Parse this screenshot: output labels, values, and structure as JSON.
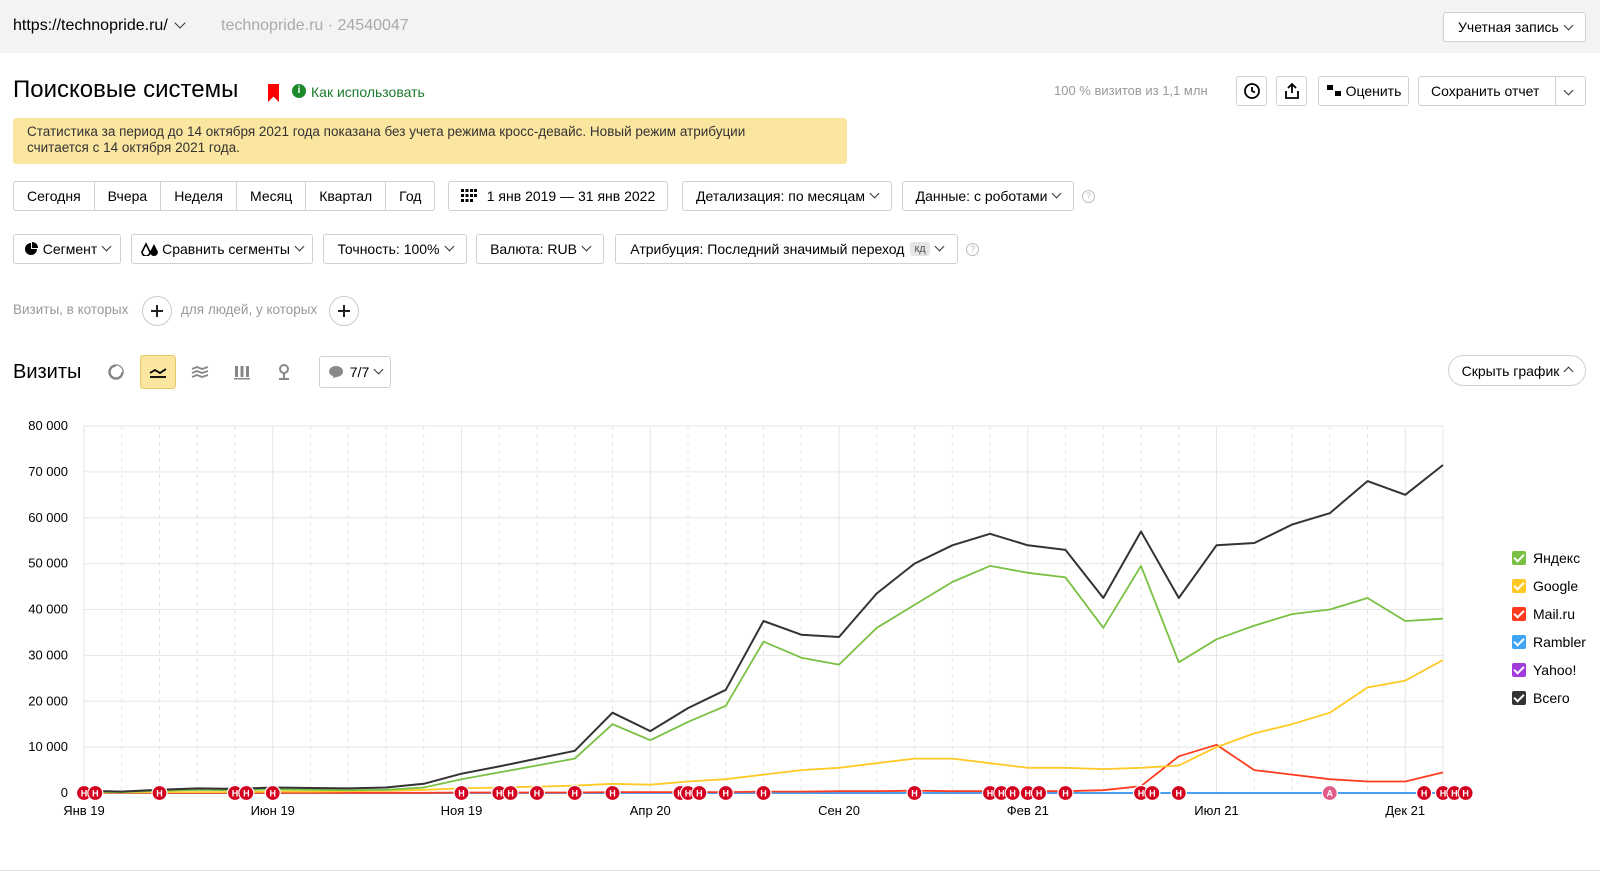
{
  "topbar": {
    "site": "https://technopride.ru/",
    "counter": "technopride.ru · 24540047",
    "account": "Учетная запись"
  },
  "header": {
    "title": "Поисковые системы",
    "howto": "Как использовать",
    "visits_share": "100 % визитов из 1,1 млн",
    "rate_label": "Оценить",
    "save_report": "Сохранить отчет"
  },
  "notice": {
    "line1": "Статистика за период до 14 октября 2021 года показана без учета режима кросс-девайс. Новый режим атрибуции",
    "line2": "считается с 14 октября 2021 года."
  },
  "period": {
    "items": [
      "Сегодня",
      "Вчера",
      "Неделя",
      "Месяц",
      "Квартал",
      "Год"
    ],
    "range": "1 янв 2019 — 31 янв 2022",
    "detail": "Детализация: по месяцам",
    "data": "Данные: с роботами"
  },
  "settings": {
    "segment": "Сегмент",
    "compare": "Сравнить сегменты",
    "accuracy": "Точность: 100%",
    "currency": "Валюта: RUB",
    "attribution": "Атрибуция: Последний значимый переход",
    "attribution_badge": "кд"
  },
  "filters": {
    "visits_label": "Визиты, в которых",
    "people_label": "для людей, у которых"
  },
  "chart_header": {
    "title": "Визиты",
    "annotations": "7/7",
    "hide": "Скрыть график"
  },
  "chart_data": {
    "type": "line",
    "ylim": [
      0,
      80000
    ],
    "yticks": [
      0,
      10000,
      20000,
      30000,
      40000,
      50000,
      60000,
      70000,
      80000
    ],
    "ytick_labels": [
      "0",
      "10 000",
      "20 000",
      "30 000",
      "40 000",
      "50 000",
      "60 000",
      "70 000",
      "80 000"
    ],
    "x_count": 37,
    "xtick_labels": [
      {
        "i": 0,
        "label": "Янв 19"
      },
      {
        "i": 5,
        "label": "Июн 19"
      },
      {
        "i": 10,
        "label": "Ноя 19"
      },
      {
        "i": 15,
        "label": "Апр 20"
      },
      {
        "i": 20,
        "label": "Сен 20"
      },
      {
        "i": 25,
        "label": "Фев 21"
      },
      {
        "i": 30,
        "label": "Июл 21"
      },
      {
        "i": 35,
        "label": "Дек 21"
      }
    ],
    "series": [
      {
        "name": "Яндекс",
        "color": "#7ac143",
        "values": [
          300,
          200,
          500,
          700,
          600,
          800,
          700,
          600,
          700,
          1200,
          3000,
          4500,
          6000,
          7500,
          15000,
          11500,
          15500,
          19000,
          33000,
          29500,
          28000,
          36000,
          41000,
          46000,
          49500,
          48000,
          47000,
          36000,
          49500,
          28500,
          33500,
          36500,
          39000,
          40000,
          42500,
          37500,
          38000
        ]
      },
      {
        "name": "Google",
        "color": "#ffc926",
        "values": [
          100,
          100,
          200,
          200,
          200,
          300,
          300,
          400,
          500,
          700,
          1000,
          1200,
          1400,
          1600,
          2000,
          1800,
          2500,
          3000,
          4000,
          5000,
          5500,
          6500,
          7500,
          7500,
          6500,
          5500,
          5500,
          5200,
          5500,
          6000,
          10000,
          13000,
          15000,
          17500,
          23000,
          24500,
          29000
        ]
      },
      {
        "name": "Mail.ru",
        "color": "#ff3b1f",
        "values": [
          50,
          50,
          50,
          50,
          50,
          50,
          50,
          50,
          50,
          50,
          100,
          100,
          100,
          100,
          200,
          200,
          200,
          200,
          300,
          300,
          400,
          400,
          500,
          400,
          400,
          400,
          400,
          600,
          1500,
          8000,
          10500,
          5000,
          4000,
          3000,
          2500,
          2500,
          4500
        ]
      },
      {
        "name": "Rambler",
        "color": "#3da5f4",
        "values": [
          10,
          10,
          10,
          10,
          10,
          10,
          10,
          10,
          10,
          10,
          10,
          10,
          10,
          10,
          10,
          10,
          10,
          10,
          10,
          10,
          10,
          10,
          10,
          10,
          10,
          10,
          10,
          10,
          10,
          10,
          10,
          10,
          10,
          10,
          10,
          10,
          10
        ]
      },
      {
        "name": "Yahoo!",
        "color": "#a23bdb",
        "values": [
          5,
          5,
          5,
          5,
          5,
          5,
          5,
          5,
          5,
          5,
          5,
          5,
          5,
          5,
          5,
          5,
          5,
          5,
          5,
          5,
          5,
          5,
          5,
          5,
          5,
          5,
          5,
          5,
          5,
          5,
          5,
          5,
          5,
          5,
          5,
          5,
          5
        ]
      },
      {
        "name": "Всего",
        "color": "#333333",
        "values": [
          500,
          300,
          700,
          1000,
          900,
          1200,
          1100,
          1000,
          1200,
          2000,
          4200,
          5800,
          7500,
          9200,
          17500,
          13500,
          18500,
          22500,
          37500,
          34500,
          34000,
          43500,
          50000,
          54000,
          56500,
          54000,
          53000,
          42500,
          57000,
          42500,
          54000,
          54500,
          58500,
          61000,
          68000,
          65000,
          71500
        ]
      }
    ],
    "annotation_marker": "Н",
    "annotation_marker_alt": "А",
    "annotations_at": [
      0,
      0.3,
      2,
      4,
      4.3,
      5,
      10,
      11,
      11.3,
      12,
      13,
      14,
      15.8,
      16,
      16.3,
      17,
      18,
      22,
      24,
      24.3,
      24.6,
      25,
      25.3,
      26,
      28,
      28.3,
      29,
      35.5,
      36,
      36.3,
      36.6
    ],
    "annotations_alt_at": [
      33
    ]
  }
}
